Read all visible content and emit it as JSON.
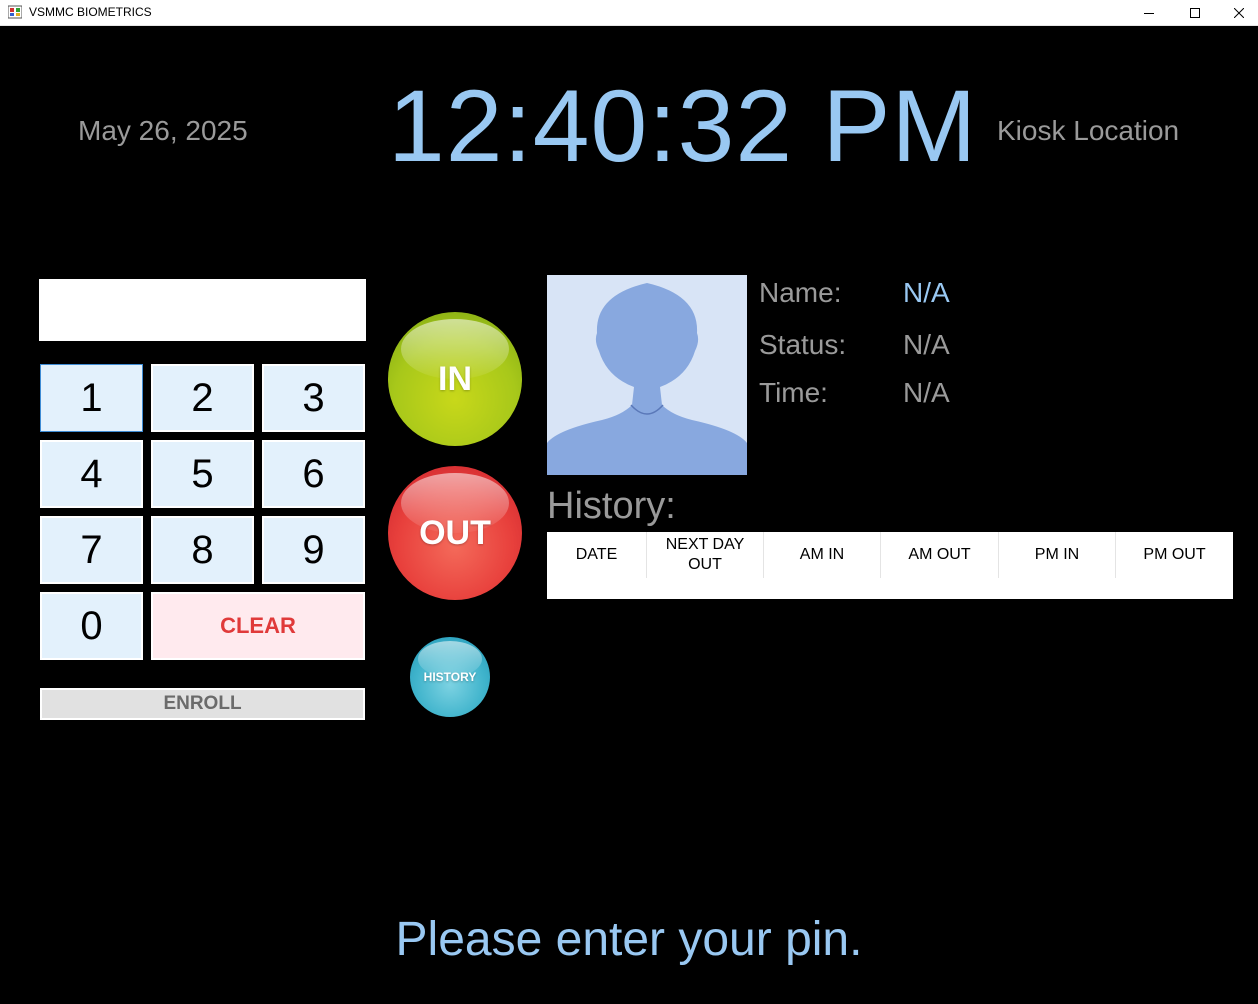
{
  "window": {
    "title": "VSMMC BIOMETRICS",
    "controls": [
      "minimize",
      "maximize",
      "close"
    ]
  },
  "header": {
    "date": "May 26, 2025",
    "clock": "12:40:32 PM",
    "location": "Kiosk Location"
  },
  "keypad": {
    "pin_value": "",
    "keys": [
      "1",
      "2",
      "3",
      "4",
      "5",
      "6",
      "7",
      "8",
      "9",
      "0"
    ],
    "clear_label": "CLEAR",
    "enroll_label": "ENROLL"
  },
  "actions": {
    "in_label": "IN",
    "out_label": "OUT",
    "history_label": "HISTORY"
  },
  "employee": {
    "name_label": "Name:",
    "name_value": "N/A",
    "status_label": "Status:",
    "status_value": "N/A",
    "time_label": "Time:",
    "time_value": "N/A"
  },
  "history": {
    "title": "History:",
    "columns": [
      "DATE",
      "NEXT DAY\nOUT",
      "AM IN",
      "AM OUT",
      "PM IN",
      "PM OUT"
    ]
  },
  "prompt": "Please enter your pin.",
  "colors": {
    "background": "#000000",
    "accent_blue": "#99c8f2",
    "muted_text": "#9a9a9a",
    "key_fill": "#e3f1fc",
    "clear_text": "#e03a3a"
  }
}
